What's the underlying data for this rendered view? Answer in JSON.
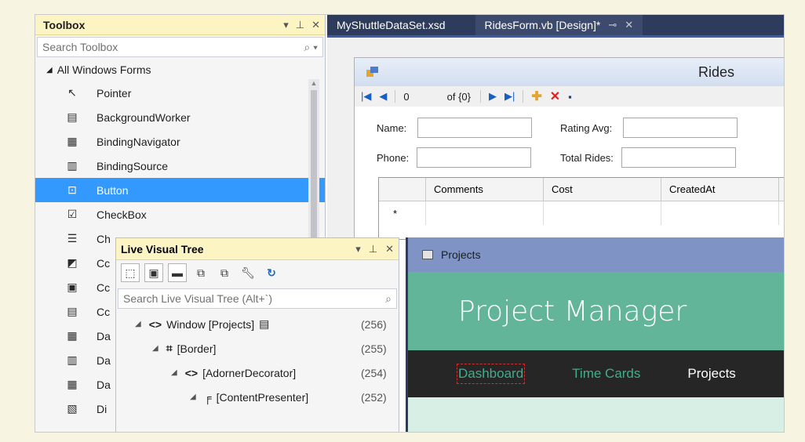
{
  "toolbox": {
    "title": "Toolbox",
    "controls": [
      "▾",
      "⊥",
      "✕"
    ],
    "search_placeholder": "Search Toolbox",
    "category": "All Windows Forms",
    "items": [
      {
        "label": "Pointer",
        "icon": "pointer-icon",
        "glyph": "↖"
      },
      {
        "label": "BackgroundWorker",
        "icon": "background-worker-icon",
        "glyph": "▤"
      },
      {
        "label": "BindingNavigator",
        "icon": "binding-navigator-icon",
        "glyph": "▦"
      },
      {
        "label": "BindingSource",
        "icon": "binding-source-icon",
        "glyph": "▥"
      },
      {
        "label": "Button",
        "icon": "button-icon",
        "glyph": "⊡",
        "selected": true
      },
      {
        "label": "CheckBox",
        "icon": "checkbox-icon",
        "glyph": "☑"
      },
      {
        "label": "Ch",
        "icon": "checkedlistbox-icon",
        "glyph": "☰"
      },
      {
        "label": "Cc",
        "icon": "colordialog-icon",
        "glyph": "◩"
      },
      {
        "label": "Cc",
        "icon": "combobox-icon",
        "glyph": "▣"
      },
      {
        "label": "Cc",
        "icon": "contextmenu-icon",
        "glyph": "▤"
      },
      {
        "label": "Da",
        "icon": "datagrid-icon",
        "glyph": "▦"
      },
      {
        "label": "Da",
        "icon": "dataset-icon",
        "glyph": "▥"
      },
      {
        "label": "Da",
        "icon": "datetimepicker-icon",
        "glyph": "▦"
      },
      {
        "label": "Di",
        "icon": "directoryentry-icon",
        "glyph": "▧"
      }
    ]
  },
  "designer": {
    "tabs": [
      {
        "label": "MyShuttleDataSet.xsd",
        "active": false
      },
      {
        "label": "RidesForm.vb [Design]*",
        "active": true,
        "pin": "⊸",
        "close": "✕"
      }
    ],
    "form": {
      "title": "Rides",
      "nav": {
        "position": "0",
        "of": "of {0}"
      },
      "fields": {
        "name_label": "Name:",
        "phone_label": "Phone:",
        "rating_label": "Rating Avg:",
        "total_label": "Total Rides:"
      },
      "grid": {
        "columns": [
          "Comments",
          "Cost",
          "CreatedAt"
        ],
        "new_row_marker": "*"
      }
    }
  },
  "live_tree": {
    "title": "Live Visual Tree",
    "controls": [
      "▾",
      "⊥",
      "✕"
    ],
    "search_placeholder": "Search Live Visual Tree (Alt+`)",
    "rows": [
      {
        "label": "Window [Projects]",
        "count": "(256)",
        "type_glyph": "<>",
        "extra": "▤"
      },
      {
        "label": "[Border]",
        "count": "(255)",
        "type_glyph": "⌗",
        "extra": ""
      },
      {
        "label": "[AdornerDecorator]",
        "count": "(254)",
        "type_glyph": "<>",
        "extra": ""
      },
      {
        "label": "[ContentPresenter]",
        "count": "(252)",
        "type_glyph": "╒",
        "extra": ""
      }
    ]
  },
  "app": {
    "window_title": "Projects",
    "banner": "Project Manager",
    "nav": [
      "Dashboard",
      "Time Cards",
      "Projects"
    ]
  },
  "colors": {
    "accent_selected": "#3399ff",
    "tool_window_header": "#fdf4c4",
    "tab_bar": "#2d3b5c",
    "app_banner": "#63b59a"
  }
}
